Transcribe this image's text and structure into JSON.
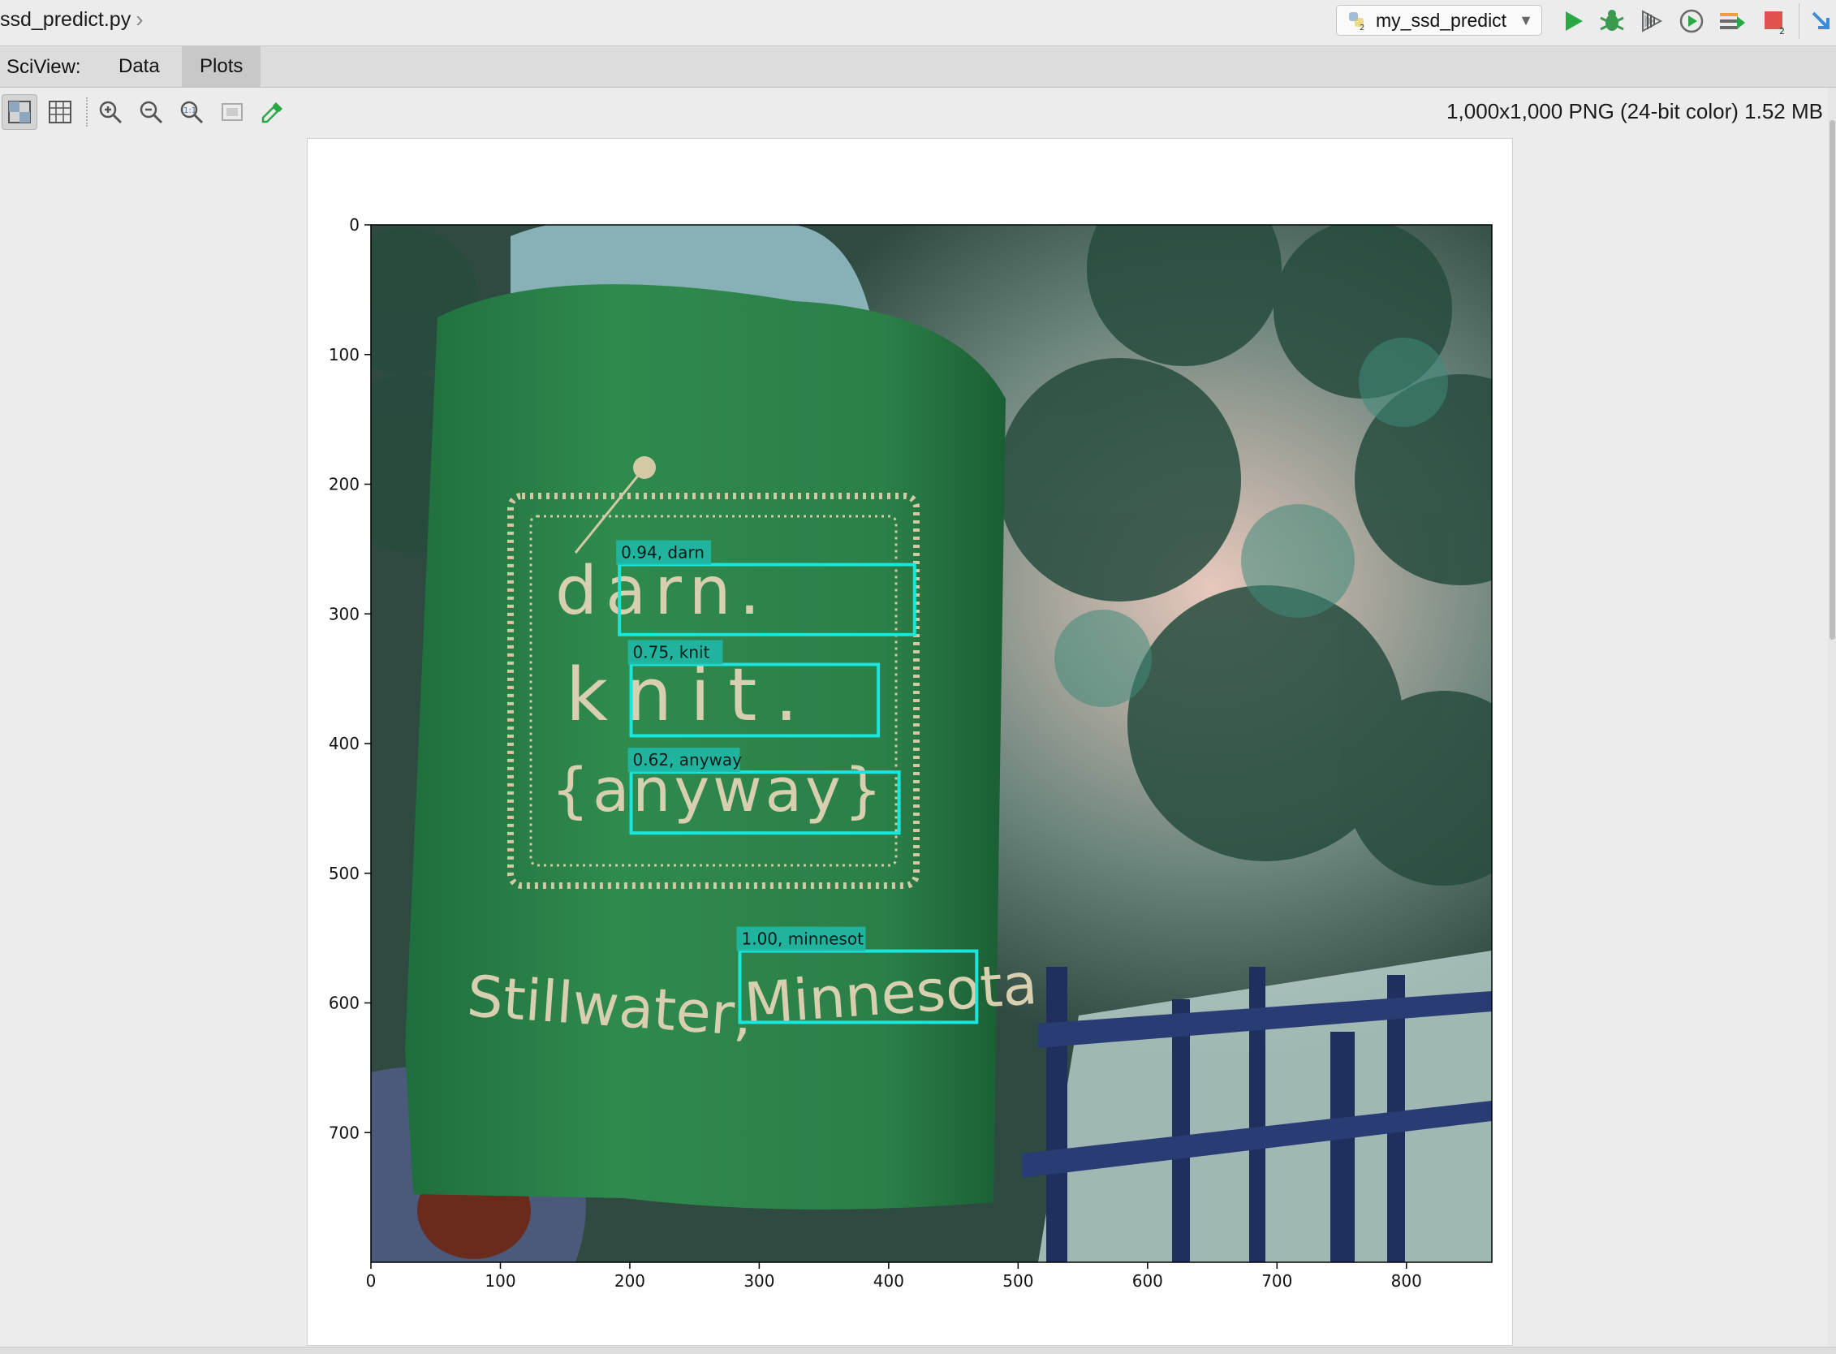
{
  "titlebar": {
    "file_name": "ssd_predict.py",
    "run_config": "my_ssd_predict"
  },
  "sciview": {
    "label": "SciView:",
    "tabs": [
      {
        "label": "Data"
      },
      {
        "label": "Plots",
        "active": true
      }
    ]
  },
  "toolbar": {
    "image_info": "1,000x1,000 PNG (24-bit color) 1.52 MB",
    "tools": [
      "chessboard-icon",
      "grid-icon",
      "zoom-in-icon",
      "zoom-out-icon",
      "actual-size-icon",
      "fit-icon",
      "color-picker-icon"
    ]
  },
  "colors": {
    "box": "#19e6dc",
    "label_bg": "#1fb8a6",
    "run_green": "#2aa845",
    "stop_red": "#e0524d"
  },
  "chart_data": {
    "type": "image",
    "x_ticks": [
      0,
      100,
      200,
      300,
      400,
      500,
      600,
      700,
      800
    ],
    "y_ticks": [
      0,
      100,
      200,
      300,
      400,
      500,
      600,
      700
    ],
    "xlim": [
      0,
      866
    ],
    "ylim": [
      800,
      0
    ],
    "detections": [
      {
        "label": "0.94, darn",
        "x0": 192,
        "y0": 262,
        "x1": 420,
        "y1": 316
      },
      {
        "label": "0.75, knit",
        "x0": 201,
        "y0": 339,
        "x1": 392,
        "y1": 394
      },
      {
        "label": "0.62, anyway",
        "x0": 201,
        "y0": 422,
        "x1": 408,
        "y1": 469
      },
      {
        "label": "1.00, minnesot",
        "x0": 285,
        "y0": 560,
        "x1": 468,
        "y1": 615
      }
    ]
  }
}
